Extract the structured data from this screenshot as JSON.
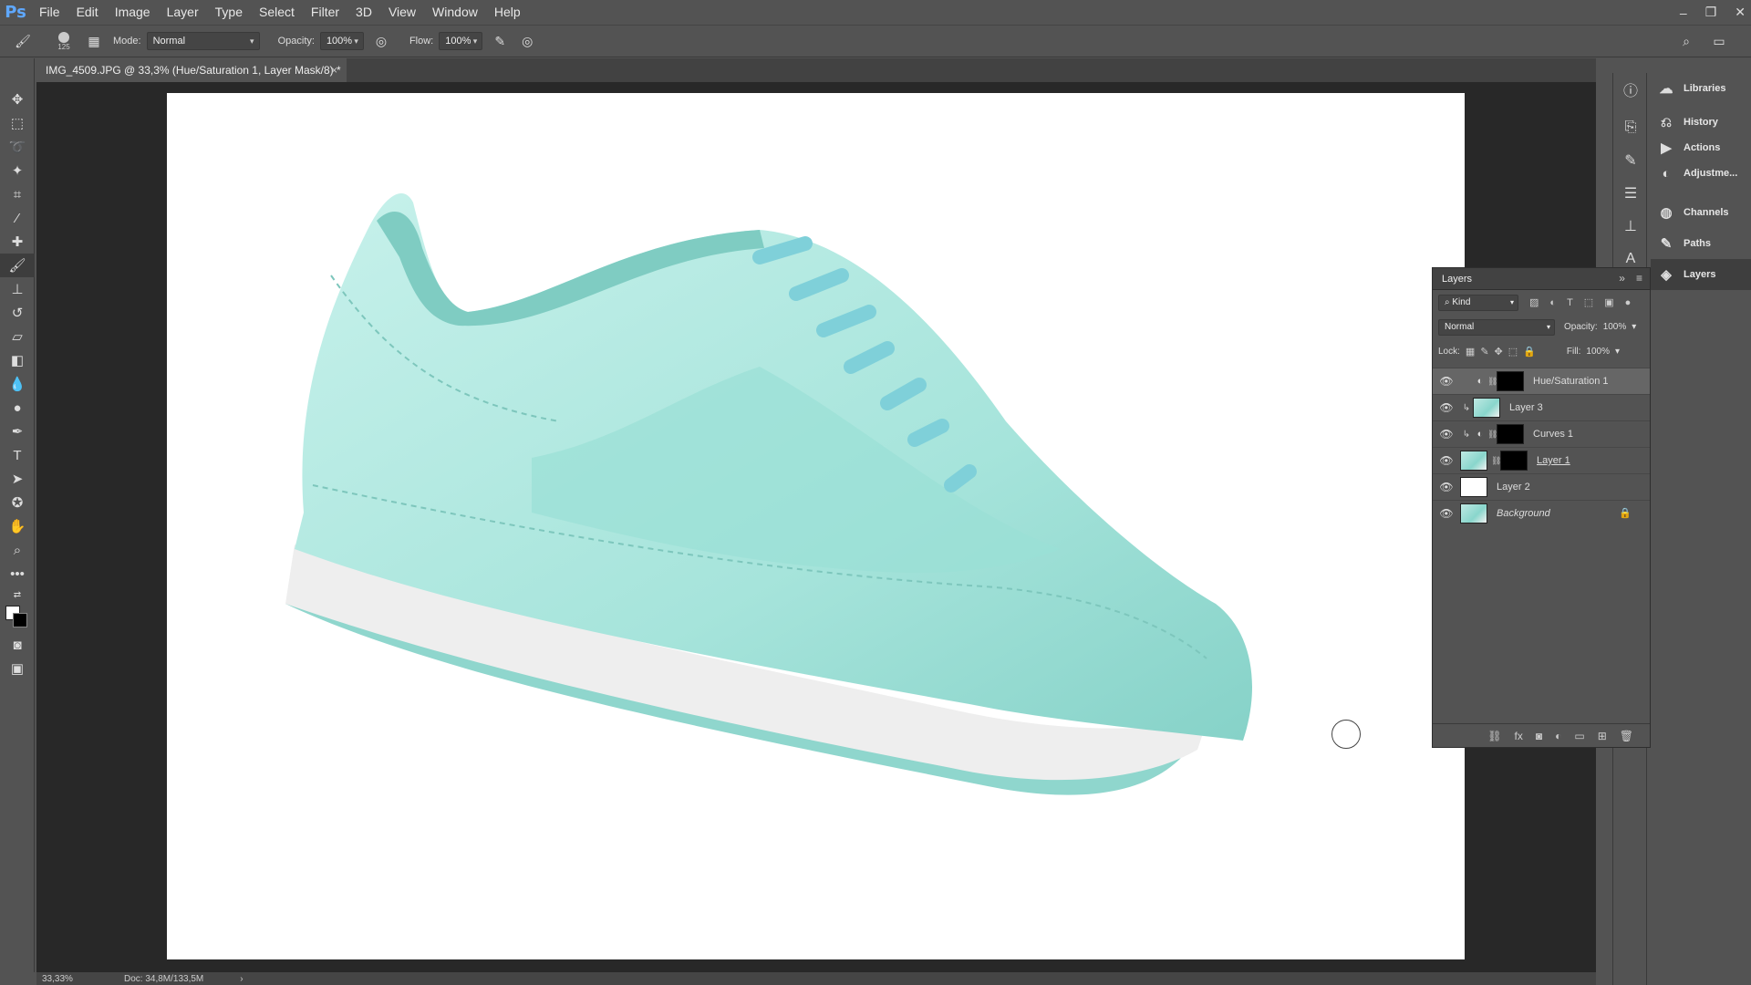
{
  "app": {
    "logo": "Ps"
  },
  "menu": [
    "File",
    "Edit",
    "Image",
    "Layer",
    "Type",
    "Select",
    "Filter",
    "3D",
    "View",
    "Window",
    "Help"
  ],
  "window_controls": {
    "minimize": "–",
    "restore": "❐",
    "close": "✕"
  },
  "options_bar": {
    "brush_size": "125",
    "mode_label": "Mode:",
    "mode_value": "Normal",
    "opacity_label": "Opacity:",
    "opacity_value": "100%",
    "flow_label": "Flow:",
    "flow_value": "100%"
  },
  "document": {
    "tab_title": "IMG_4509.JPG @ 33,3% (Hue/Saturation 1, Layer Mask/8) *",
    "tab_close": "×"
  },
  "status": {
    "zoom": "33,33%",
    "doc": "Doc: 34,8M/133,5M",
    "arrow": "›"
  },
  "side_panels": [
    {
      "label": "Libraries",
      "icon": "libraries-icon"
    },
    {
      "label": "History",
      "icon": "history-icon"
    },
    {
      "label": "Actions",
      "icon": "actions-icon"
    },
    {
      "label": "Adjustme...",
      "icon": "adjustments-icon"
    },
    {
      "label": "Channels",
      "icon": "channels-icon"
    },
    {
      "label": "Paths",
      "icon": "paths-icon"
    },
    {
      "label": "Layers",
      "icon": "layers-icon"
    }
  ],
  "layers_panel": {
    "title": "Layers",
    "kind_label": "Kind",
    "blend_mode": "Normal",
    "opacity_label": "Opacity:",
    "opacity_value": "100%",
    "lock_label": "Lock:",
    "fill_label": "Fill:",
    "fill_value": "100%",
    "layers": [
      {
        "name": "Hue/Saturation 1",
        "selected": true
      },
      {
        "name": "Layer 3"
      },
      {
        "name": "Curves 1"
      },
      {
        "name": "Layer 1"
      },
      {
        "name": "Layer 2"
      },
      {
        "name": "Background"
      }
    ]
  },
  "colors": {
    "shoe": "#a9e6dd",
    "shoe_shadow": "#7ccbc1",
    "laces": "#86d4dc",
    "sole": "#eeeeee",
    "accent_blue": "#5fa8ff"
  }
}
